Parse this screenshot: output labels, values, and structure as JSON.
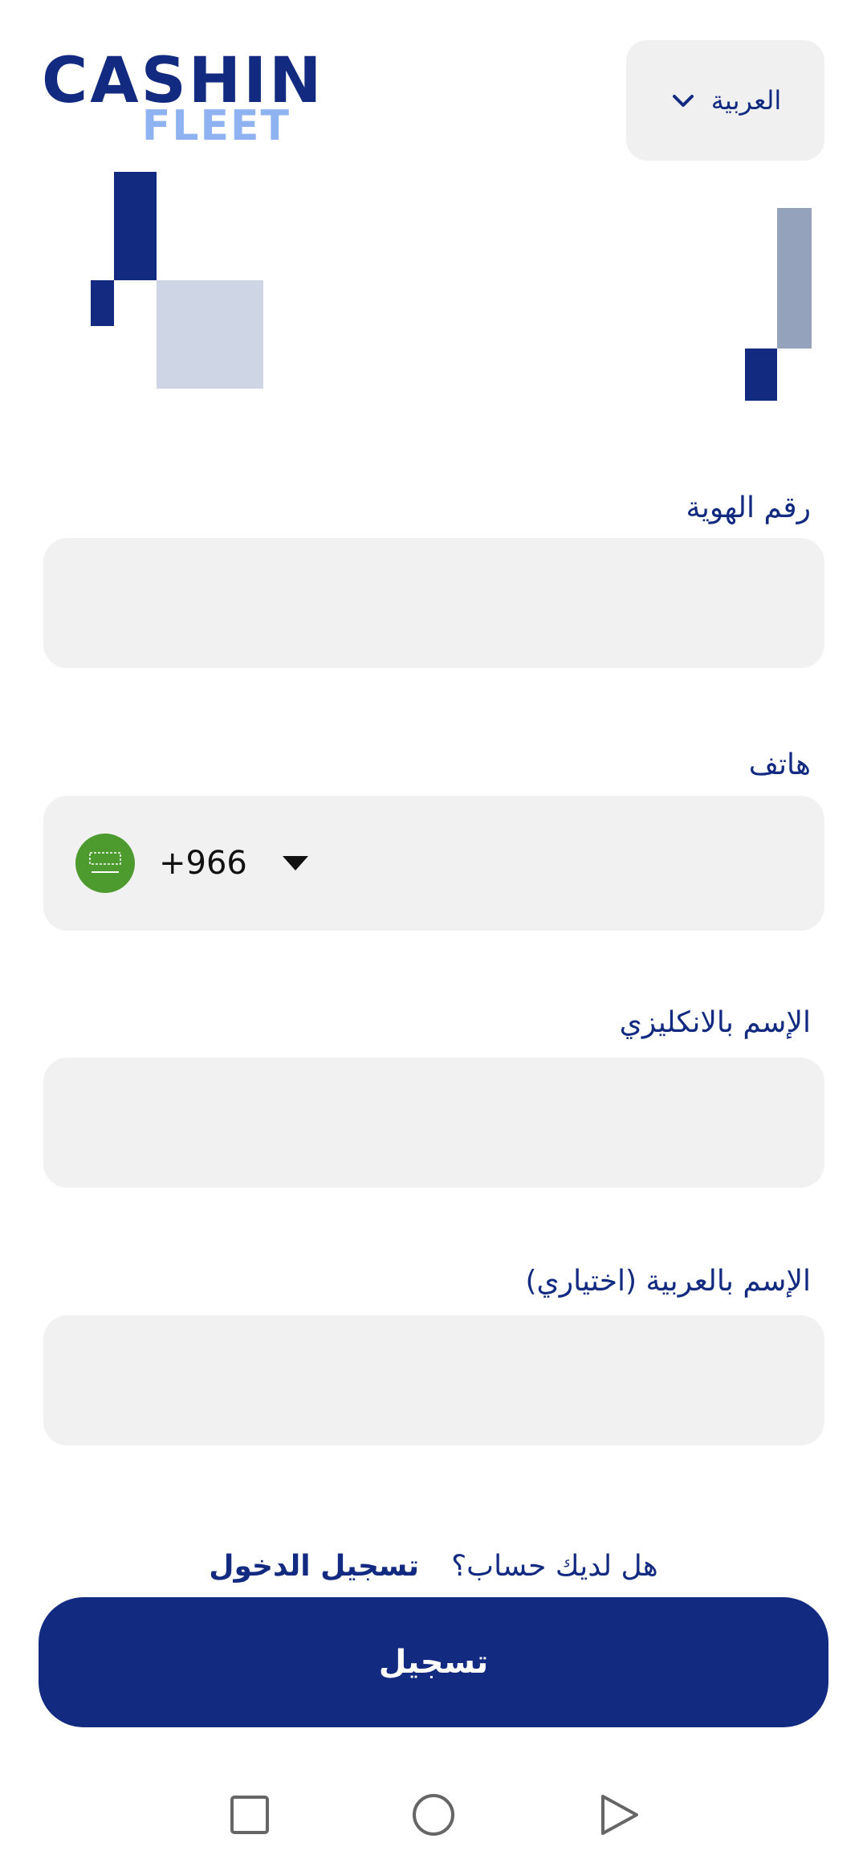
{
  "header": {
    "logo_main": "CASHIN",
    "logo_sub": "FLEET",
    "language_selected": "العربية"
  },
  "form": {
    "national_id_label": "رقم الهوية",
    "national_id_value": "",
    "phone_label": "هاتف",
    "phone_dial_code": "+966",
    "phone_value": "",
    "name_en_label": "الإسم بالانكليزي",
    "name_en_value": "",
    "name_ar_label": "الإسم بالعربية (اختياري)",
    "name_ar_value": ""
  },
  "login_prompt": {
    "question": "هل لديك حساب؟",
    "link": "تسجيل الدخول"
  },
  "register_button": "تسجيل",
  "colors": {
    "brand_navy": "#122b80",
    "brand_light_blue": "#8fb3f1",
    "field_background": "#f1f1f1",
    "deco_pale": "#ced6e6",
    "deco_slate": "#94a3bb",
    "flag_green": "#4d9a2f"
  },
  "icons": {
    "language_chevron": "chevron-down-icon",
    "country_flag": "saudi-flag-icon",
    "country_dropdown": "caret-down-icon",
    "nav_recents": "square-icon",
    "nav_home": "circle-icon",
    "nav_back": "triangle-icon"
  }
}
